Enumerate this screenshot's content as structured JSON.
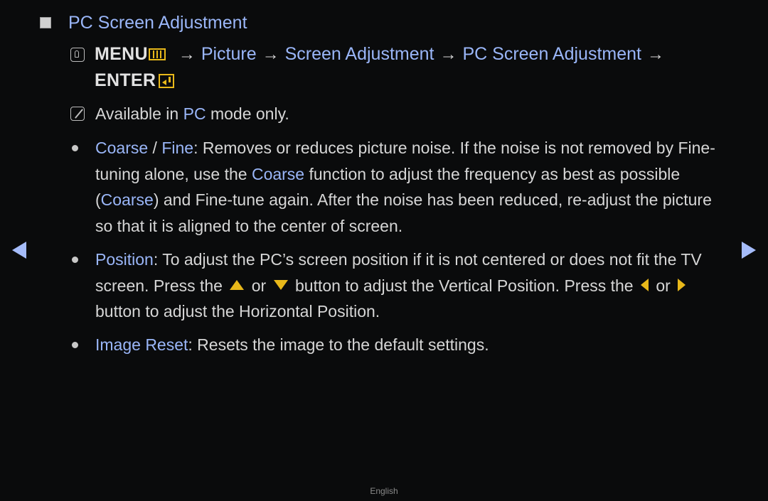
{
  "section": {
    "title": "PC Screen Adjustment",
    "bullet_icon": "square-bullet-icon"
  },
  "path": {
    "remote_icon": "remote-hand-icon",
    "menu_label": "MENU",
    "menu_icon": "menu-icon",
    "arrow": "→",
    "steps": [
      "Picture",
      "Screen Adjustment",
      "PC Screen Adjustment"
    ],
    "enter_label": "ENTER",
    "enter_icon": "enter-icon"
  },
  "note": {
    "icon": "note-icon",
    "prefix": "Available in ",
    "highlight": "PC",
    "suffix": " mode only."
  },
  "bullets": [
    {
      "parts": [
        {
          "t": "Coarse",
          "hl": true
        },
        {
          "t": " / ",
          "hl": false
        },
        {
          "t": "Fine",
          "hl": true
        },
        {
          "t": ": Removes or reduces picture noise. If the noise is not removed by Fine-tuning alone, use the ",
          "hl": false
        },
        {
          "t": "Coarse",
          "hl": true
        },
        {
          "t": " function to adjust the frequency as best as possible (",
          "hl": false
        },
        {
          "t": "Coarse",
          "hl": true
        },
        {
          "t": ") and Fine-tune again. After the noise has been reduced, re-adjust the picture so that it is aligned to the center of screen.",
          "hl": false
        }
      ]
    },
    {
      "parts": [
        {
          "t": "Position",
          "hl": true
        },
        {
          "t": ": To adjust the PC’s screen position if it is not centered or does not fit the TV screen. Press the ",
          "hl": false
        },
        {
          "icon": "up"
        },
        {
          "t": " or ",
          "hl": false
        },
        {
          "icon": "down"
        },
        {
          "t": " button to adjust the Vertical Position. Press the ",
          "hl": false
        },
        {
          "icon": "left"
        },
        {
          "t": " or ",
          "hl": false
        },
        {
          "icon": "right"
        },
        {
          "t": " button to adjust the Horizontal Position.",
          "hl": false
        }
      ]
    },
    {
      "parts": [
        {
          "t": "Image Reset",
          "hl": true
        },
        {
          "t": ": Resets the image to the default settings.",
          "hl": false
        }
      ]
    }
  ],
  "nav": {
    "prev_icon": "previous-page-arrow-icon",
    "next_icon": "next-page-arrow-icon"
  },
  "footer": {
    "language": "English"
  },
  "colors": {
    "background": "#0a0b0c",
    "highlight": "#9ab6f8",
    "text": "#d6d6d6",
    "button_icon": "#e8b81a",
    "nav_arrow": "#a5bcfa"
  }
}
